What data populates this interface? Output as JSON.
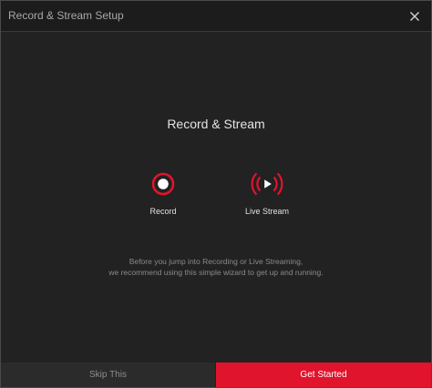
{
  "window": {
    "title": "Record & Stream Setup"
  },
  "main": {
    "heading": "Record & Stream",
    "options": [
      {
        "label": "Record",
        "icon": "record-icon"
      },
      {
        "label": "Live Stream",
        "icon": "live-stream-icon"
      }
    ],
    "description_line1": "Before you jump into Recording or Live Streaming,",
    "description_line2": "we recommend using this simple wizard to get up and running."
  },
  "footer": {
    "skip_label": "Skip This",
    "start_label": "Get Started"
  },
  "colors": {
    "accent": "#e0142c",
    "background": "#222222",
    "titlebar": "#1c1c1c"
  }
}
